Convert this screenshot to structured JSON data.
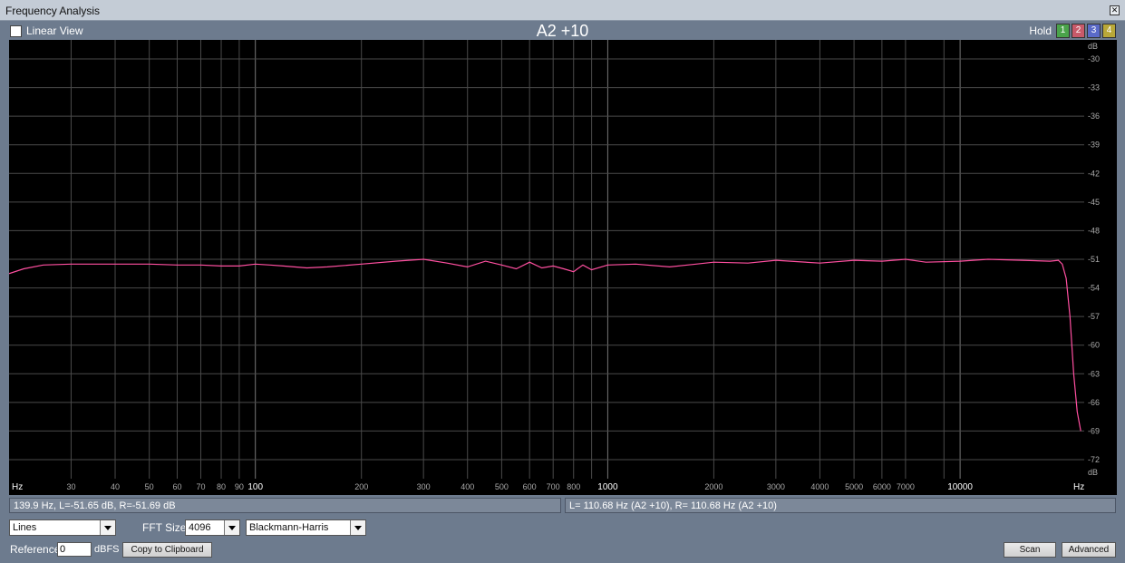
{
  "window": {
    "title": "Frequency Analysis",
    "close_icon": "close-icon"
  },
  "toolbar": {
    "linear_view_label": "Linear View",
    "linear_view_checked": false,
    "hold_label": "Hold",
    "hold_buttons": [
      {
        "label": "1",
        "color": "#4aa34a"
      },
      {
        "label": "2",
        "color": "#c85a6a"
      },
      {
        "label": "3",
        "color": "#5a6ac8"
      },
      {
        "label": "4",
        "color": "#b9a838"
      }
    ]
  },
  "chart_data": {
    "type": "line",
    "title": "A2 +10",
    "x_scale": "log",
    "xlim": [
      20,
      22500
    ],
    "ylim": [
      -74,
      -28
    ],
    "x_unit_label": "Hz",
    "y_unit_label": "dB",
    "x_ticks": [
      {
        "value": 30,
        "label": "30"
      },
      {
        "value": 40,
        "label": "40"
      },
      {
        "value": 50,
        "label": "50"
      },
      {
        "value": 60,
        "label": "60"
      },
      {
        "value": 70,
        "label": "70"
      },
      {
        "value": 80,
        "label": "80"
      },
      {
        "value": 90,
        "label": "90"
      },
      {
        "value": 100,
        "label": "100"
      },
      {
        "value": 200,
        "label": "200"
      },
      {
        "value": 300,
        "label": "300"
      },
      {
        "value": 400,
        "label": "400"
      },
      {
        "value": 500,
        "label": "500"
      },
      {
        "value": 600,
        "label": "600"
      },
      {
        "value": 700,
        "label": "700"
      },
      {
        "value": 800,
        "label": "800"
      },
      {
        "value": 1000,
        "label": "1000"
      },
      {
        "value": 2000,
        "label": "2000"
      },
      {
        "value": 3000,
        "label": "3000"
      },
      {
        "value": 4000,
        "label": "4000"
      },
      {
        "value": 5000,
        "label": "5000"
      },
      {
        "value": 6000,
        "label": "6000"
      },
      {
        "value": 7000,
        "label": "7000"
      },
      {
        "value": 10000,
        "label": "10000"
      }
    ],
    "x_minor_grid": [
      900,
      9000
    ],
    "y_ticks": [
      -30,
      -33,
      -36,
      -39,
      -42,
      -45,
      -48,
      -51,
      -54,
      -57,
      -60,
      -63,
      -66,
      -69,
      -72
    ],
    "grid": true,
    "background": "#000000",
    "grid_color": "#4a4a4a",
    "series": [
      {
        "color": "#ff4fa0",
        "x": [
          20,
          22,
          25,
          30,
          40,
          50,
          60,
          70,
          80,
          90,
          100,
          110,
          120,
          140,
          160,
          200,
          250,
          300,
          350,
          400,
          450,
          500,
          550,
          600,
          650,
          700,
          750,
          800,
          850,
          900,
          1000,
          1200,
          1500,
          2000,
          2500,
          3000,
          4000,
          5000,
          6000,
          7000,
          8000,
          10000,
          12000,
          15000,
          18000,
          19000,
          19500,
          20000,
          20500,
          21000,
          21500,
          22000
        ],
        "y": [
          -52.5,
          -52.0,
          -51.6,
          -51.5,
          -51.5,
          -51.5,
          -51.6,
          -51.6,
          -51.7,
          -51.7,
          -51.5,
          -51.6,
          -51.7,
          -51.9,
          -51.8,
          -51.5,
          -51.2,
          -51.0,
          -51.4,
          -51.8,
          -51.2,
          -51.6,
          -52.0,
          -51.3,
          -51.9,
          -51.7,
          -52.0,
          -52.3,
          -51.6,
          -52.1,
          -51.6,
          -51.5,
          -51.8,
          -51.3,
          -51.4,
          -51.1,
          -51.4,
          -51.1,
          -51.2,
          -51.0,
          -51.3,
          -51.2,
          -51.0,
          -51.1,
          -51.2,
          -51.1,
          -51.5,
          -53.0,
          -57.0,
          -63.0,
          -67.0,
          -69.0
        ]
      }
    ]
  },
  "status": {
    "cursor_readout": "139.9 Hz, L=-51.65 dB, R=-51.69 dB",
    "peak_readout": "L= 110.68 Hz (A2 +10), R= 110.68 Hz (A2 +10)"
  },
  "controls": {
    "display_mode": "Lines",
    "fft_size_label": "FFT Size",
    "fft_size_value": "4096",
    "window_function": "Blackmann-Harris",
    "reference_label": "Reference",
    "reference_value": "0",
    "reference_unit": "dBFS",
    "copy_button": "Copy to Clipboard",
    "scan_button": "Scan",
    "advanced_button": "Advanced"
  }
}
